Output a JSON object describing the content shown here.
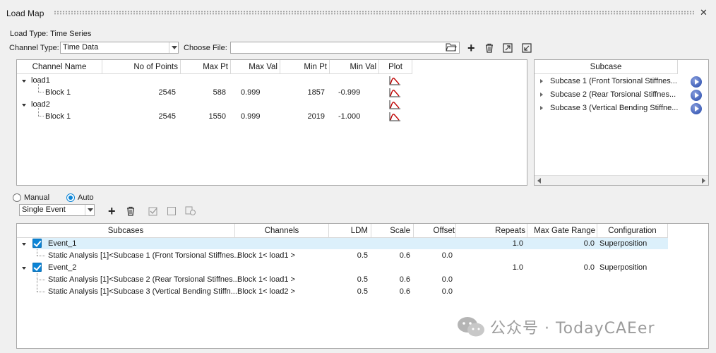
{
  "window": {
    "title": "Load Map"
  },
  "load_type": {
    "label": "Load Type: Time Series"
  },
  "channel_type": {
    "label": "Channel Type:",
    "value": "Time Data"
  },
  "choose_file": {
    "label": "Choose File:",
    "value": ""
  },
  "channel_table": {
    "columns": [
      "Channel Name",
      "No of Points",
      "Max Pt",
      "Max Val",
      "Min Pt",
      "Min Val",
      "Plot"
    ],
    "rows": [
      {
        "name": "load1",
        "type": "group"
      },
      {
        "name": "Block 1",
        "no_points": "2545",
        "max_pt": "588",
        "max_val": "0.999",
        "min_pt": "1857",
        "min_val": "-0.999"
      },
      {
        "name": "load2",
        "type": "group"
      },
      {
        "name": "Block 1",
        "no_points": "2545",
        "max_pt": "1550",
        "max_val": "0.999",
        "min_pt": "2019",
        "min_val": "-1.000"
      }
    ]
  },
  "subcase_panel": {
    "header": "Subcase",
    "items": [
      "Subcase 1 (Front Torsional Stiffnes...",
      "Subcase 2 (Rear Torsional Stiffnes...",
      "Subcase 3 (Vertical Bending Stiffne..."
    ]
  },
  "mode": {
    "manual": "Manual",
    "auto": "Auto",
    "selected": "Auto"
  },
  "event_type": {
    "value": "Single Event"
  },
  "event_table": {
    "columns": [
      "Subcases",
      "Channels",
      "LDM",
      "Scale",
      "Offset",
      "Repeats",
      "Max Gate Range",
      "Configuration"
    ],
    "rows": [
      {
        "subcases": "Event_1",
        "channels": "",
        "ldm": "",
        "scale": "",
        "offset": "",
        "repeats": "1.0",
        "max_gate": "0.0",
        "config": "Superposition"
      },
      {
        "subcases": "Static Analysis [1]<Subcase 1 (Front Torsional Stiffnes...",
        "channels": "Block 1< load1 >",
        "ldm": "0.5",
        "scale": "0.6",
        "offset": "0.0",
        "repeats": "",
        "max_gate": "",
        "config": ""
      },
      {
        "subcases": "Event_2",
        "channels": "",
        "ldm": "",
        "scale": "",
        "offset": "",
        "repeats": "1.0",
        "max_gate": "0.0",
        "config": "Superposition"
      },
      {
        "subcases": "Static Analysis [1]<Subcase 2 (Rear Torsional Stiffnes...",
        "channels": "Block 1< load1 >",
        "ldm": "0.5",
        "scale": "0.6",
        "offset": "0.0",
        "repeats": "",
        "max_gate": "",
        "config": ""
      },
      {
        "subcases": "Static Analysis [1]<Subcase 3 (Vertical Bending Stiffn...",
        "channels": "Block 1< load2 >",
        "ldm": "0.5",
        "scale": "0.6",
        "offset": "0.0",
        "repeats": "",
        "max_gate": "",
        "config": ""
      }
    ]
  },
  "watermark": {
    "text": "公众号 · TodayCAEer"
  },
  "colors": {
    "accent": "#0b84d6",
    "selection": "#dcf0fb",
    "plot_icon": "#c00000"
  }
}
